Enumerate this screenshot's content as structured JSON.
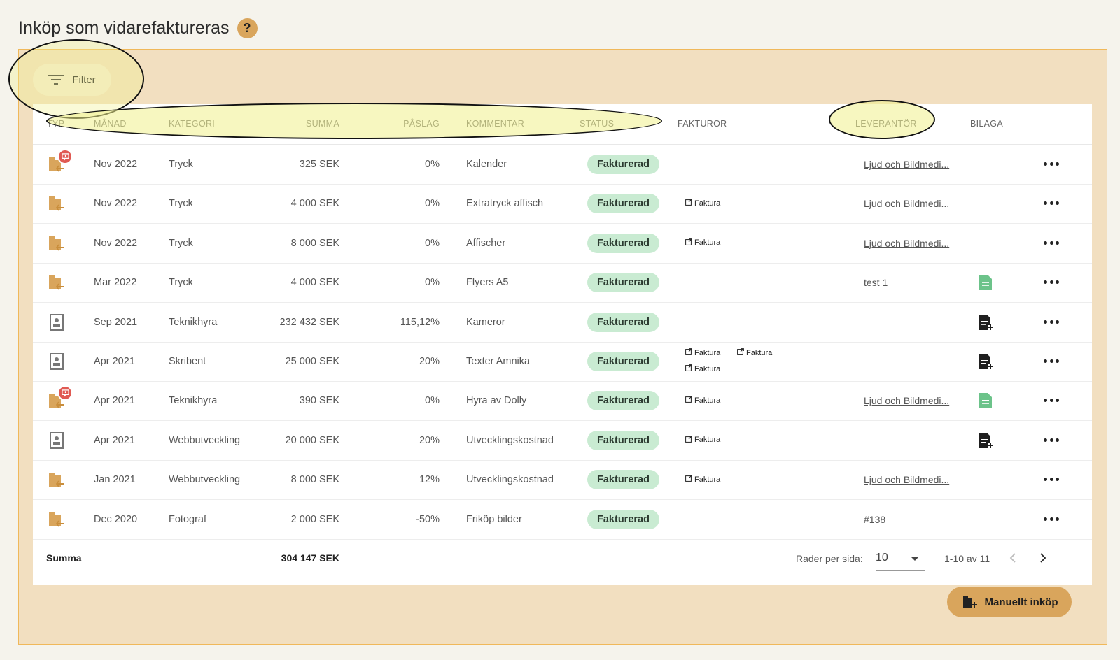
{
  "page": {
    "title": "Inköp som vidarefaktureras",
    "help": "?"
  },
  "toolbar": {
    "filter_label": "Filter"
  },
  "table": {
    "headers": {
      "typ": "TYP",
      "manad": "MÅNAD",
      "kategori": "KATEGORI",
      "summa": "SUMMA",
      "paslag": "PÅSLAG",
      "kommentar": "KOMMENTAR",
      "status": "STATUS",
      "fakturor": "FAKTUROR",
      "leverantor": "LEVERANTÖR",
      "bilaga": "BILAGA"
    },
    "invoice_label": "Faktura",
    "rows": [
      {
        "type": "purchase-box-icon",
        "has_note": true,
        "month": "Nov 2022",
        "category": "Tryck",
        "sum": "325 SEK",
        "markup": "0%",
        "comment": "Kalender",
        "status": "Fakturerad",
        "invoices": [],
        "supplier": "Ljud och Bildmedi...",
        "attachment": ""
      },
      {
        "type": "purchase-box-icon",
        "has_note": false,
        "month": "Nov 2022",
        "category": "Tryck",
        "sum": "4 000 SEK",
        "markup": "0%",
        "comment": "Extratryck affisch",
        "status": "Fakturerad",
        "invoices": [
          "Faktura"
        ],
        "supplier": "Ljud och Bildmedi...",
        "attachment": ""
      },
      {
        "type": "purchase-box-icon",
        "has_note": false,
        "month": "Nov 2022",
        "category": "Tryck",
        "sum": "8 000 SEK",
        "markup": "0%",
        "comment": "Affischer",
        "status": "Fakturerad",
        "invoices": [
          "Faktura"
        ],
        "supplier": "Ljud och Bildmedi...",
        "attachment": ""
      },
      {
        "type": "purchase-box-icon",
        "has_note": false,
        "month": "Mar 2022",
        "category": "Tryck",
        "sum": "4 000 SEK",
        "markup": "0%",
        "comment": "Flyers A5",
        "status": "Fakturerad",
        "invoices": [],
        "supplier": "test 1",
        "attachment": "document-icon"
      },
      {
        "type": "contact-card-icon",
        "has_note": false,
        "month": "Sep 2021",
        "category": "Teknikhyra",
        "sum": "232 432 SEK",
        "markup": "115,12%",
        "comment": "Kameror",
        "status": "Fakturerad",
        "invoices": [],
        "supplier": "",
        "attachment": "add-document-icon"
      },
      {
        "type": "contact-card-icon",
        "has_note": false,
        "month": "Apr 2021",
        "category": "Skribent",
        "sum": "25 000 SEK",
        "markup": "20%",
        "comment": "Texter Amnika",
        "status": "Fakturerad",
        "invoices": [
          "Faktura",
          "Faktura",
          "Faktura"
        ],
        "supplier": "",
        "attachment": "add-document-icon"
      },
      {
        "type": "purchase-box-icon",
        "has_note": true,
        "month": "Apr 2021",
        "category": "Teknikhyra",
        "sum": "390 SEK",
        "markup": "0%",
        "comment": "Hyra av Dolly",
        "status": "Fakturerad",
        "invoices": [
          "Faktura"
        ],
        "supplier": "Ljud och Bildmedi...",
        "attachment": "document-icon"
      },
      {
        "type": "contact-card-icon",
        "has_note": false,
        "month": "Apr 2021",
        "category": "Webbutveckling",
        "sum": "20 000 SEK",
        "markup": "20%",
        "comment": "Utvecklingskostnad",
        "status": "Fakturerad",
        "invoices": [
          "Faktura"
        ],
        "supplier": "",
        "attachment": "add-document-icon"
      },
      {
        "type": "purchase-box-icon",
        "has_note": false,
        "month": "Jan 2021",
        "category": "Webbutveckling",
        "sum": "8 000 SEK",
        "markup": "12%",
        "comment": "Utvecklingskostnad",
        "status": "Fakturerad",
        "invoices": [
          "Faktura"
        ],
        "supplier": "Ljud och Bildmedi...",
        "attachment": ""
      },
      {
        "type": "purchase-box-icon",
        "has_note": false,
        "month": "Dec 2020",
        "category": "Fotograf",
        "sum": "2 000 SEK",
        "markup": "-50%",
        "comment": "Friköp bilder",
        "status": "Fakturerad",
        "invoices": [],
        "supplier": "#138",
        "attachment": ""
      }
    ],
    "footer": {
      "sum_label": "Summa",
      "sum_total": "304 147 SEK",
      "rows_per_page_label": "Rader per sida:",
      "rows_per_page_value": "10",
      "range": "1-10 av 11"
    }
  },
  "actions": {
    "manual_purchase_label": "Manuellt inköp"
  },
  "colors": {
    "accent": "#d9a55c",
    "panel_bg": "#f2dfc0",
    "status_bg": "#c9ebd2",
    "note_badge": "#e05a53",
    "attachment_green": "#6cc38a"
  }
}
